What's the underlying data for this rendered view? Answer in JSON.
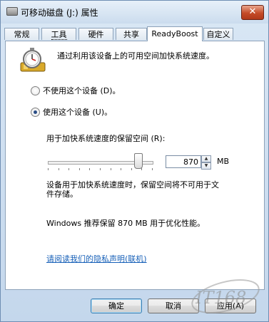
{
  "window": {
    "title": "可移动磁盘 (J:) 属性",
    "close_label": "✕"
  },
  "tabs": [
    {
      "label": "常规"
    },
    {
      "label": "工具"
    },
    {
      "label": "硬件"
    },
    {
      "label": "共享"
    },
    {
      "label": "ReadyBoost"
    },
    {
      "label": "自定义"
    }
  ],
  "panel": {
    "intro": "通过利用该设备上的可用空间加快系统速度。",
    "radio_off": {
      "label": "不使用这个设备 (D)。",
      "checked": false
    },
    "radio_on": {
      "label": "使用这个设备 (U)。",
      "checked": true
    },
    "reserve_label": "用于加快系统速度的保留空间 (R):",
    "slider": {
      "value_fraction": 0.86
    },
    "reserve_value": "870",
    "unit": "MB",
    "info": "设备用于加快系统速度时，保留空间将不可用于文件存储。",
    "recommend": "Windows 推荐保留 870 MB 用于优化性能。",
    "privacy_link": "请阅读我们的隐私声明(联机)"
  },
  "buttons": {
    "ok": "确定",
    "cancel": "取消",
    "apply": "应用(A)"
  },
  "watermark": "IT168.com",
  "colors": {
    "titlebar": "#cbdcee",
    "link": "#1760b8",
    "close": "#c44b28"
  }
}
